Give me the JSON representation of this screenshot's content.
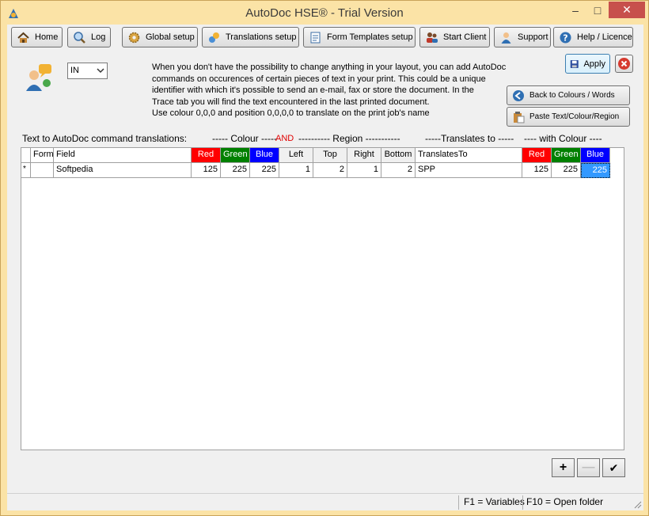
{
  "window": {
    "title": "AutoDoc HSE® - Trial Version",
    "minimize": "–",
    "maximize": "□",
    "close": "✕"
  },
  "toolbar": [
    {
      "label": "Home",
      "icon": "house-icon"
    },
    {
      "label": "Log",
      "icon": "magnifier-icon"
    },
    {
      "label": "Global setup",
      "icon": "gear-icon"
    },
    {
      "label": "Translations setup",
      "icon": "translate-icon"
    },
    {
      "label": "Form Templates setup",
      "icon": "form-icon"
    },
    {
      "label": "Start Client",
      "icon": "users-icon"
    },
    {
      "label": "Support",
      "icon": "support-user-icon"
    },
    {
      "label": "Help / Licence",
      "icon": "help-icon"
    }
  ],
  "direction_select": {
    "value": "IN"
  },
  "info_lines": [
    "When you don't have the possibility to change anything in your layout, you can add AutoDoc",
    "commands on occurences of certain pieces of text in your print. This could be a unique",
    "identifier with which it's possible to send an e-mail, fax or store the document. In the",
    "Trace tab you will find the text encountered in the last printed document.",
    "Use colour 0,0,0 and position 0,0,0,0 to translate on the print job's name"
  ],
  "buttons": {
    "apply": "Apply",
    "back_to_colours": "Back to Colours / Words",
    "paste": "Paste Text/Colour/Region"
  },
  "legend": {
    "prefix": "Text to AutoDoc command translations:",
    "colour": "----- Colour -----",
    "and": "AND",
    "region": "---------- Region -----------",
    "translates": "-----Translates to -----",
    "with_colour": "---- with Colour ----"
  },
  "table": {
    "columns": [
      "",
      "Form",
      "Field",
      "Red",
      "Green",
      "Blue",
      "Left",
      "Top",
      "Right",
      "Bottom",
      "TranslatesTo",
      "Red",
      "Green",
      "Blue"
    ],
    "rows": [
      [
        "*",
        "",
        "Softpedia",
        "125",
        "225",
        "225",
        "1",
        "2",
        "1",
        "2",
        "SPP",
        "125",
        "225",
        "225"
      ]
    ]
  },
  "grid_nav": {
    "add": "+",
    "remove": "—",
    "confirm": "✔"
  },
  "status": {
    "variables": "F1 = Variables",
    "open_folder": "F10 = Open folder"
  },
  "colors": {
    "title_bar": "#fbe3a6",
    "header_red": "#ff0000",
    "header_green": "#008000",
    "header_blue": "#0000ff",
    "selection": "#3399ff"
  }
}
